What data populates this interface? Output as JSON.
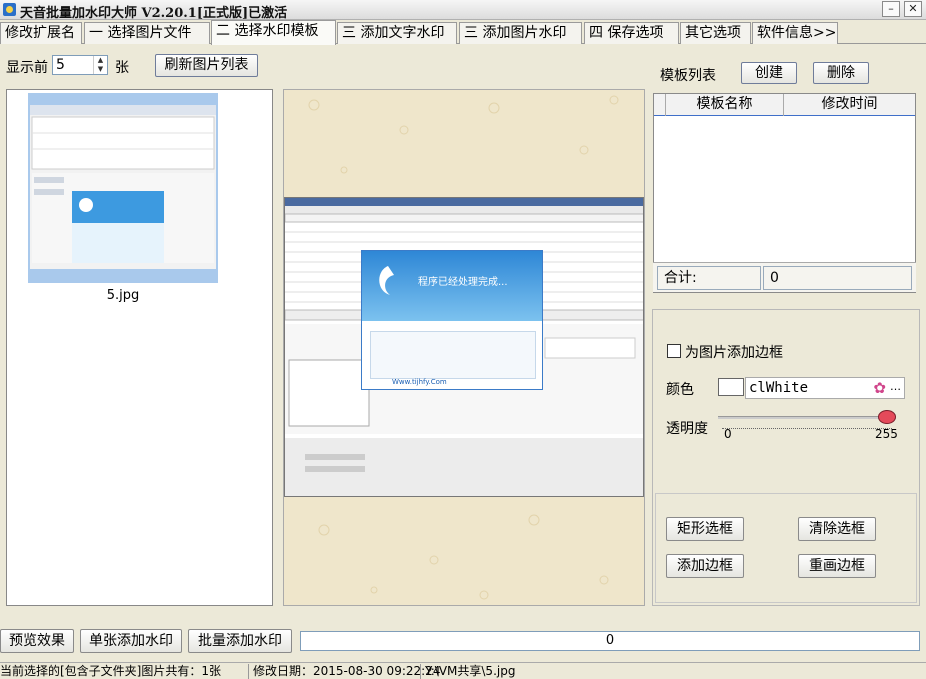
{
  "window": {
    "title": "天音批量加水印大师 V2.20.1[正式版]已激活",
    "minimize": "–",
    "close": "✕"
  },
  "tabs": [
    {
      "label": "修改扩展名"
    },
    {
      "label": "一 选择图片文件"
    },
    {
      "label": "二 选择水印模板"
    },
    {
      "label": "三 添加文字水印"
    },
    {
      "label": "三 添加图片水印"
    },
    {
      "label": "四 保存选项"
    },
    {
      "label": "其它选项"
    },
    {
      "label": "软件信息>>"
    }
  ],
  "active_tab": 2,
  "toolbar": {
    "show_prefix": "显示前",
    "show_count": "5",
    "show_suffix": "张",
    "refresh_label": "刷新图片列表"
  },
  "thumbnails": [
    {
      "name": "5.jpg"
    }
  ],
  "template_panel": {
    "title": "模板列表",
    "create_label": "创建",
    "delete_label": "删除",
    "columns": [
      "模板名称",
      "修改时间"
    ],
    "rows": [],
    "total_label": "合计:",
    "total_value": "0"
  },
  "border_options": {
    "add_border_label": "为图片添加边框",
    "add_border_checked": false,
    "color_label": "颜色",
    "color_value": "clWhite",
    "opacity_label": "透明度",
    "opacity_min": "0",
    "opacity_max": "255",
    "opacity_value": 255,
    "rect_select_label": "矩形选框",
    "clear_select_label": "清除选框",
    "add_border_button": "添加边框",
    "redraw_border_button": "重画边框"
  },
  "preview_popup": {
    "title": "程序已经处理完成...",
    "footer": "Www.tijhfy.Com"
  },
  "actions": {
    "preview_label": "预览效果",
    "single_label": "单张添加水印",
    "batch_label": "批量添加水印",
    "progress_text": "0",
    "progress_value": 0
  },
  "status": {
    "count_text": "当前选择的[包含子文件夹]图片共有：1张",
    "date_text": "修改日期：2015-08-30 09:22:24",
    "path_text": "Y:\\VM共享\\5.jpg"
  },
  "colors": {
    "accent": "#3f6fc9",
    "window_bg": "#ece9d8",
    "preview_bg": "#efe6cb",
    "slider_thumb": "#e44a5a"
  }
}
